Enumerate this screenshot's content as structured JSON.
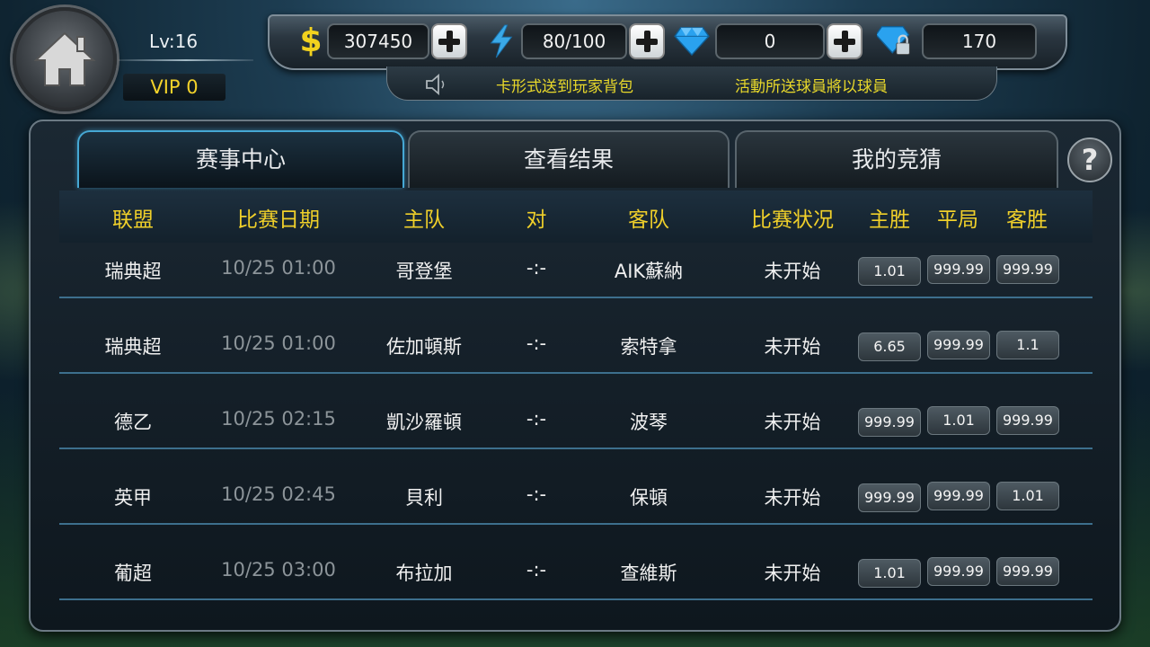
{
  "player": {
    "level": "Lv:16",
    "vip": "VIP 0"
  },
  "resources": {
    "gold": "307450",
    "energy": "80/100",
    "diamonds": "0",
    "locked_diamonds": "170"
  },
  "marquee": {
    "left": "卡形式送到玩家背包",
    "right": "活動所送球員將以球員"
  },
  "tabs": [
    {
      "label": "赛事中心",
      "active": true
    },
    {
      "label": "查看结果",
      "active": false
    },
    {
      "label": "我的竞猜",
      "active": false
    }
  ],
  "help_label": "?",
  "table": {
    "headers": [
      "联盟",
      "比赛日期",
      "主队",
      "对",
      "客队",
      "比赛状况",
      "主胜",
      "平局",
      "客胜"
    ],
    "rows": [
      {
        "league": "瑞典超",
        "date": "10/25 01:00",
        "home": "哥登堡",
        "vs": "-:-",
        "away": "AIK蘇納",
        "status": "未开始",
        "home_win": "1.01",
        "draw": "999.99",
        "away_win": "999.99"
      },
      {
        "league": "瑞典超",
        "date": "10/25 01:00",
        "home": "佐加頓斯",
        "vs": "-:-",
        "away": "索特拿",
        "status": "未开始",
        "home_win": "6.65",
        "draw": "999.99",
        "away_win": "1.1"
      },
      {
        "league": "德乙",
        "date": "10/25 02:15",
        "home": "凱沙羅頓",
        "vs": "-:-",
        "away": "波琴",
        "status": "未开始",
        "home_win": "999.99",
        "draw": "1.01",
        "away_win": "999.99"
      },
      {
        "league": "英甲",
        "date": "10/25 02:45",
        "home": "貝利",
        "vs": "-:-",
        "away": "保頓",
        "status": "未开始",
        "home_win": "999.99",
        "draw": "999.99",
        "away_win": "1.01"
      },
      {
        "league": "葡超",
        "date": "10/25 03:00",
        "home": "布拉加",
        "vs": "-:-",
        "away": "查維斯",
        "status": "未开始",
        "home_win": "1.01",
        "draw": "999.99",
        "away_win": "999.99"
      }
    ]
  },
  "colors": {
    "header_text": "#f0d02a",
    "vip_text": "#f3d22a",
    "active_tab_border": "#46a8d4",
    "row_divider": "#3d6f8d"
  }
}
